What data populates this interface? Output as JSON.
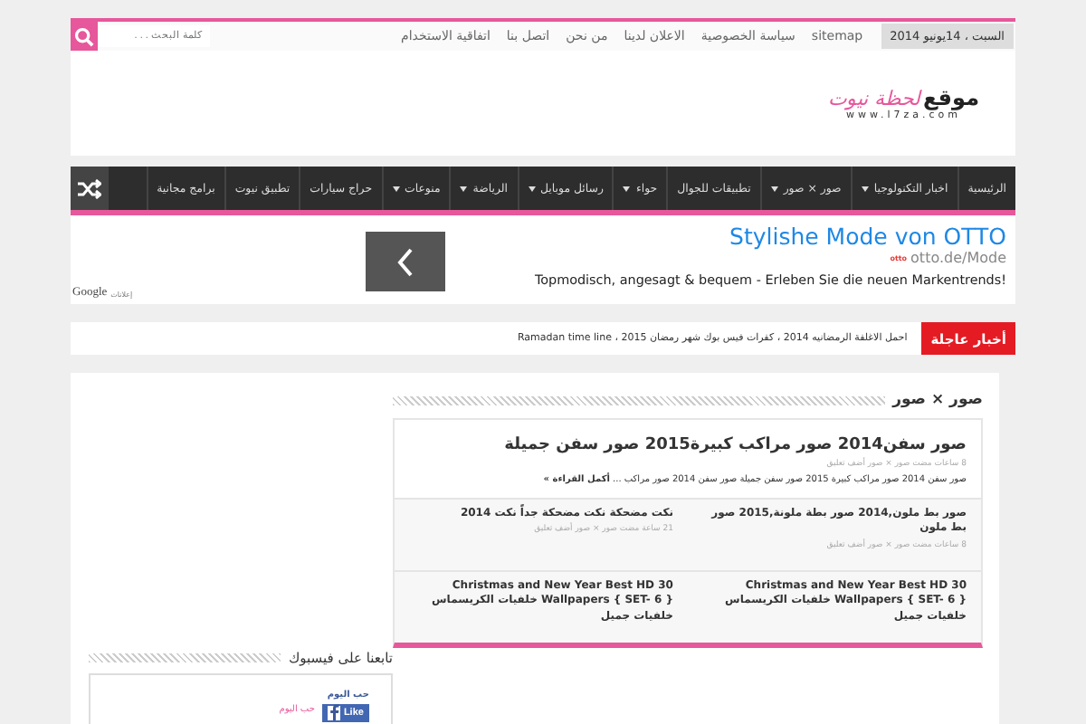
{
  "top_bar": {
    "date": "السبت ، 14يونيو 2014",
    "links": [
      "sitemap",
      "سياسة الخصوصية",
      "الاعلان لدينا",
      "من نحن",
      "اتصل بنا",
      "اتفاقية الاستخدام"
    ],
    "search": {
      "placeholder": "كلمة البحث . . ."
    }
  },
  "logo": {
    "word": "موقع",
    "script": "لحظة نيوت",
    "url": "www.l7za.com"
  },
  "nav": [
    {
      "label": "الرئيسية",
      "has_menu": false
    },
    {
      "label": "اخبار التكنولوجيا",
      "has_menu": true
    },
    {
      "label": "صور × صور",
      "has_menu": true
    },
    {
      "label": "تطبيقات للجوال",
      "has_menu": false
    },
    {
      "label": "حواء",
      "has_menu": true
    },
    {
      "label": "رسائل موبايل",
      "has_menu": true
    },
    {
      "label": "الرياضة",
      "has_menu": true
    },
    {
      "label": "منوعات",
      "has_menu": true
    },
    {
      "label": "حراج سيارات",
      "has_menu": false
    },
    {
      "label": "تطبيق نيوت",
      "has_menu": false
    },
    {
      "label": "برامج مجانية",
      "has_menu": false
    }
  ],
  "ad": {
    "title": "Stylishe Mode von OTTO",
    "url": "otto.de/Mode",
    "brand": "otto",
    "description": "Topmodisch, angesagt & bequem - Erleben Sie die neuen Markentrends!",
    "provider": "Google",
    "label": "إعلانات"
  },
  "breaking": {
    "label": "أخبار عاجلة",
    "text": "احمل الاغلفة الرمضانيه 2014 ، كفرات فيس بوك شهر رمضان 2015 ، Ramadan time line"
  },
  "section": {
    "title": "صور × صور",
    "featured": {
      "title": "صور سفن2014 صور مراكب كبيرة2015 صور سفن جميلة",
      "meta": "8 ساعات مضت صور × صور أضف تعليق",
      "excerpt": "صور سفن 2014 صور مراكب كبيرة 2015 صور سفن جميلة صور سفن 2014 صور مراكب ... **أكمل القراءة »**"
    },
    "posts": [
      {
        "title": "صور بط ملون,2014 صور بطة ملونة,2015 صور بط ملون",
        "meta": "8 ساعات مضت صور × صور أضف تعليق"
      },
      {
        "title": "نكت مضحكة نكت مضحكة جداً نكت 2014",
        "meta": "21 ساعة مضت صور × صور أضف تعليق"
      },
      {
        "title": "Christmas and New Year Best HD 30 Wallpapers { SET- 6 } خلفيات الكريسماس خلفيات جميل"
      },
      {
        "title": "Christmas and New Year Best HD 30 Wallpapers { SET- 6 } خلفيات الكريسماس خلفيات جميل"
      }
    ]
  },
  "facebook": {
    "title": "تابعنا على فيسبوك",
    "page": "حب اليوم",
    "logo_text": "حب اليوم",
    "like": "Like"
  }
}
